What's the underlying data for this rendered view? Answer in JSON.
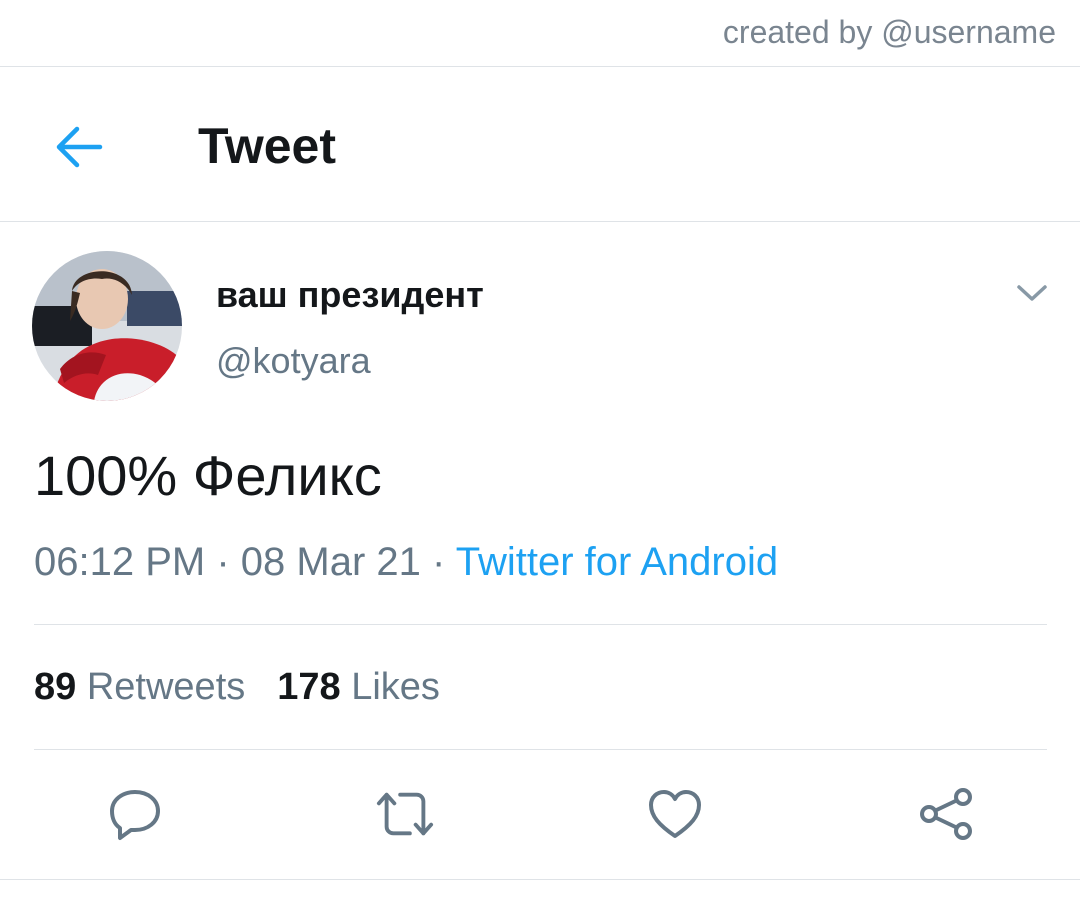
{
  "watermark": "created by @username",
  "header": {
    "title": "Tweet",
    "back_icon": "arrow-left-icon"
  },
  "tweet": {
    "author": {
      "display_name": "ваш президент",
      "handle": "@kotyara"
    },
    "text": "100% Феликс",
    "time": "06:12 PM",
    "date": "08 Mar 21",
    "separator": "·",
    "source": "Twitter for Android",
    "stats": {
      "retweets_count": "89",
      "retweets_label": "Retweets",
      "likes_count": "178",
      "likes_label": "Likes"
    }
  },
  "actions": [
    "reply-icon",
    "retweet-icon",
    "like-icon",
    "share-icon"
  ],
  "colors": {
    "accent": "#1da1f2",
    "secondary_text": "#657786",
    "primary_text": "#14171a",
    "divider": "#dfe3e7",
    "icon": "#657786"
  }
}
